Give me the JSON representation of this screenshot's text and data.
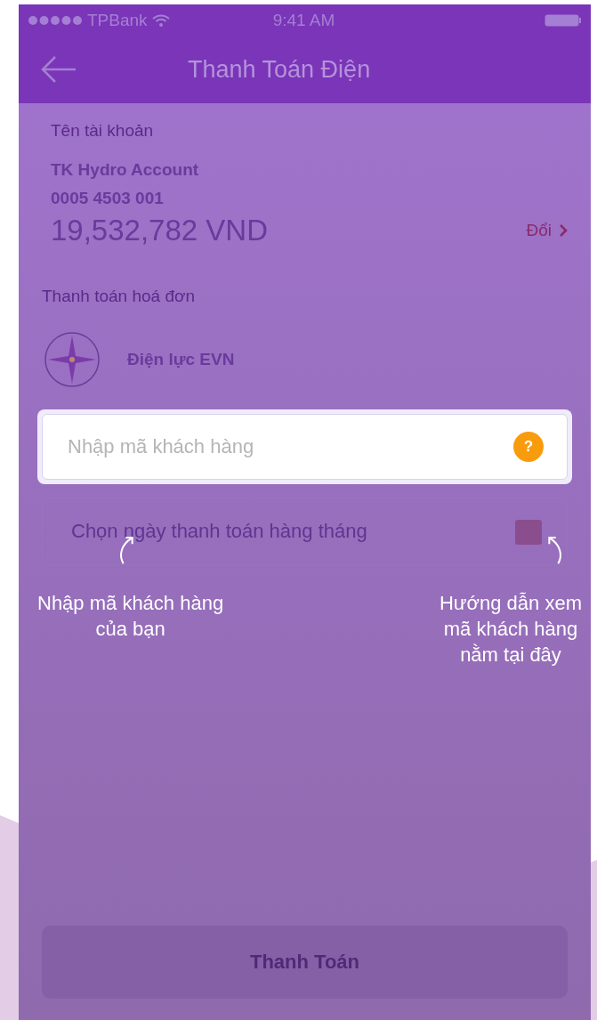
{
  "status_bar": {
    "carrier": "TPBank",
    "time": "9:41 AM"
  },
  "header": {
    "title": "Thanh Toán Điện"
  },
  "account": {
    "label": "Tên tài khoản",
    "name": "TK Hydro Account",
    "number": "0005 4503 001",
    "balance": "19,532,782 VND",
    "change_link": "Đổi"
  },
  "bill": {
    "section_label": "Thanh toán hoá đơn",
    "provider": "Điện lực EVN"
  },
  "customer_field": {
    "placeholder": "Nhập mã khách hàng",
    "help": "?"
  },
  "date_field": {
    "placeholder": "Chọn ngày thanh toán hàng tháng"
  },
  "hints": [
    {
      "text": "Nhập mã khách hàng\ncủa bạn",
      "kind": "left"
    },
    {
      "text": "Hướng dẫn xem\nmã khách hàng\nnằm tại đây",
      "kind": "right"
    }
  ],
  "pay_button": {
    "label": "Thanh Toán",
    "disabled": true
  }
}
